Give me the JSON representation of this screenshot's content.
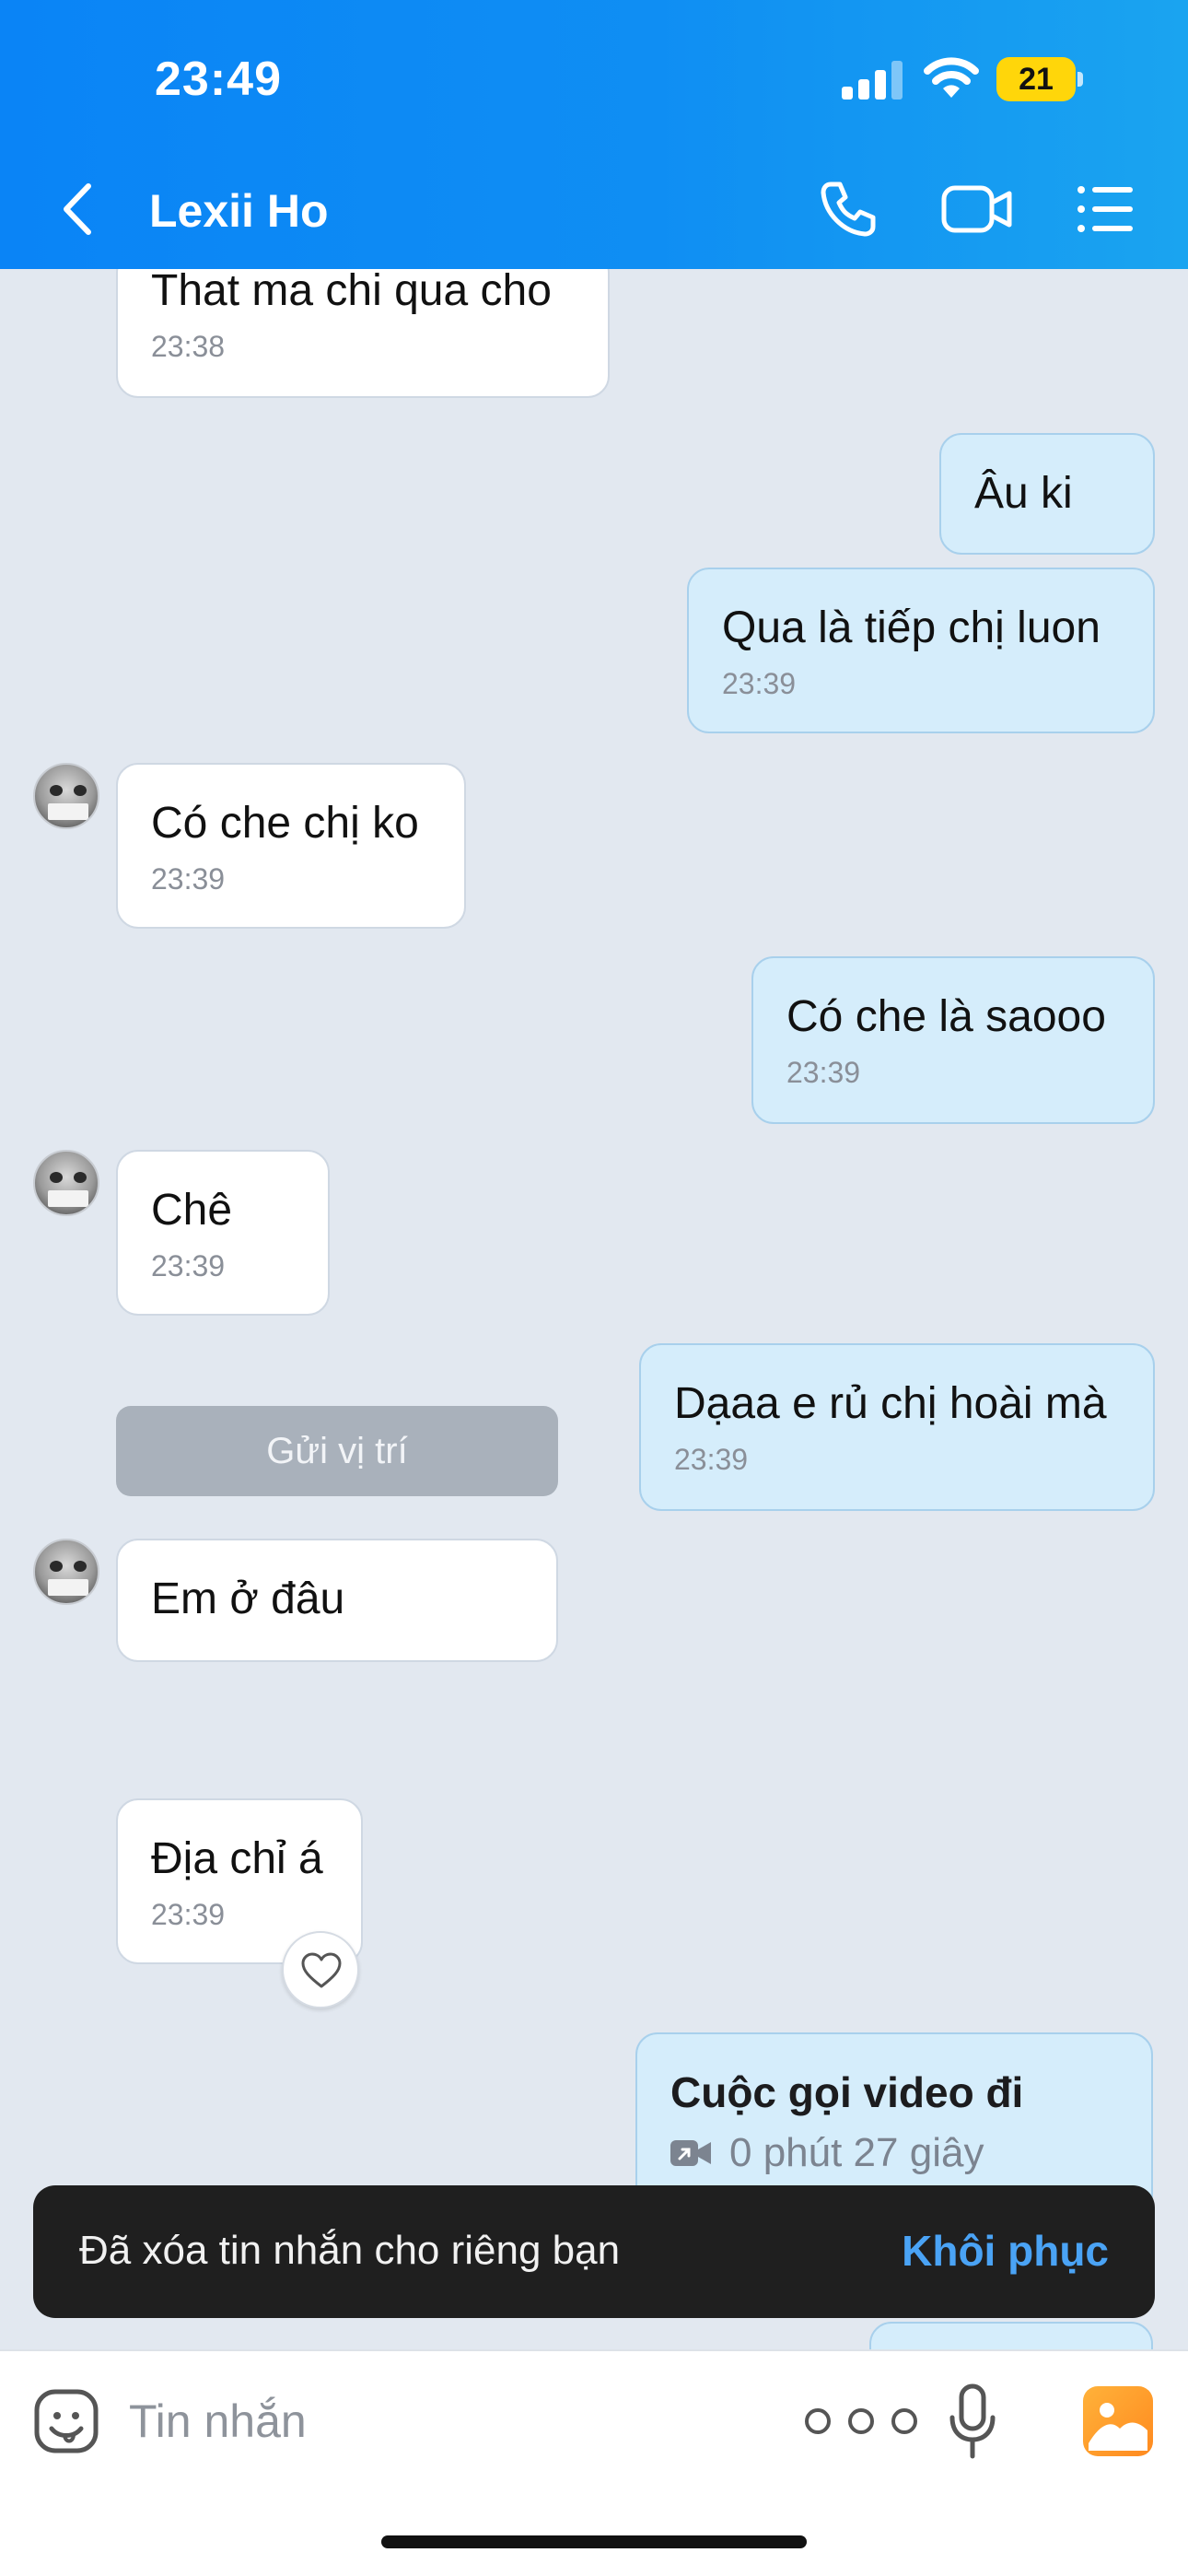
{
  "status_bar": {
    "time": "23:49",
    "battery": "21"
  },
  "header": {
    "contact_name": "Lexii Ho"
  },
  "messages": [
    {
      "dir": "in",
      "text": "That ma chi qua cho",
      "time": "23:38"
    },
    {
      "dir": "out",
      "text": "Âu ki",
      "time": ""
    },
    {
      "dir": "out",
      "text": "Qua là tiếp chị luon",
      "time": "23:39"
    },
    {
      "dir": "in",
      "text": "Có che chị ko",
      "time": "23:39"
    },
    {
      "dir": "out",
      "text": "Có che là saooo",
      "time": "23:39"
    },
    {
      "dir": "in",
      "text": "Chê",
      "time": "23:39"
    },
    {
      "dir": "out",
      "text": "Dạaa e rủ chị hoài mà",
      "time": "23:39"
    },
    {
      "dir": "in",
      "text": "Em ở đâu",
      "time": ""
    },
    {
      "dir": "in",
      "text": "Địa chỉ á",
      "time": "23:39"
    }
  ],
  "location_button": "Gửi vị trí",
  "call_card": {
    "title": "Cuộc gọi video đi",
    "duration": "0 phút 27 giây"
  },
  "toast": {
    "text": "Đã xóa tin nhắn cho riêng bạn",
    "action": "Khôi phục"
  },
  "input": {
    "placeholder": "Tin nhắn",
    "value": ""
  },
  "colors": {
    "header_blue": "#0a84f6",
    "outgoing_bubble": "#d5edfb",
    "toast_action": "#4aa3f5"
  },
  "icons": [
    "back-icon",
    "phone-icon",
    "video-camera-icon",
    "menu-list-icon",
    "heart-icon",
    "video-call-icon",
    "sticker-icon",
    "more-icon",
    "microphone-icon",
    "gallery-icon"
  ]
}
